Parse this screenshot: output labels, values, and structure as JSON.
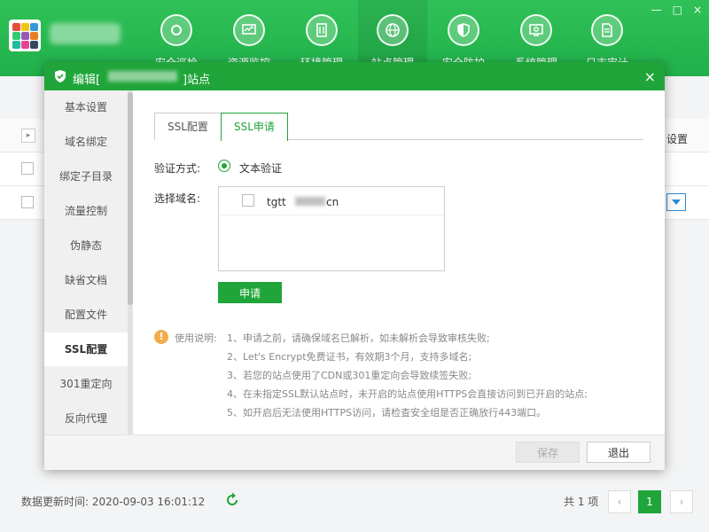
{
  "header": {
    "nav": [
      {
        "label": "安全巡检",
        "icon": "gear-cycle-icon",
        "active": false
      },
      {
        "label": "资源监控",
        "icon": "monitor-chart-icon",
        "active": false
      },
      {
        "label": "环境管理",
        "icon": "server-stack-icon",
        "active": false
      },
      {
        "label": "站点管理",
        "icon": "globe-icon",
        "active": true
      },
      {
        "label": "安全防护",
        "icon": "shield-icon",
        "active": false
      },
      {
        "label": "系统管理",
        "icon": "display-gear-icon",
        "active": false
      },
      {
        "label": "日志审计",
        "icon": "document-icon",
        "active": false
      }
    ],
    "window_controls": [
      "—",
      "□",
      "×"
    ]
  },
  "background": {
    "column_header_right": "设置",
    "update_text": "数据更新时间: 2020-09-03 16:01:12",
    "pager": {
      "total": "共 1 项",
      "prev": "‹",
      "current": "1",
      "next": "›"
    }
  },
  "modal": {
    "title_prefix": "编辑[",
    "title_suffix": "]站点",
    "close": "×",
    "side_menu": [
      {
        "label": "基本设置",
        "active": false
      },
      {
        "label": "域名绑定",
        "active": false
      },
      {
        "label": "绑定子目录",
        "active": false
      },
      {
        "label": "流量控制",
        "active": false
      },
      {
        "label": "伪静态",
        "active": false
      },
      {
        "label": "缺省文档",
        "active": false
      },
      {
        "label": "配置文件",
        "active": false
      },
      {
        "label": "SSL配置",
        "active": true
      },
      {
        "label": "301重定向",
        "active": false
      },
      {
        "label": "反向代理",
        "active": false
      }
    ],
    "tabs": [
      {
        "label": "SSL配置",
        "active": false
      },
      {
        "label": "SSL申请",
        "active": true
      }
    ],
    "verify_label": "验证方式:",
    "verify_option": "文本验证",
    "domain_label": "选择域名:",
    "domain": {
      "prefix": "tgtt",
      "suffix": "cn",
      "checked": false
    },
    "apply_button": "申请",
    "notes_label": "使用说明:",
    "notes": [
      "1、申请之前，请确保域名已解析，如未解析会导致审核失败;",
      "2、Let's Encrypt免费证书，有效期3个月，支持多域名;",
      "3、若您的站点使用了CDN或301重定向会导致续签失败;",
      "4、在未指定SSL默认站点时，未开启的站点使用HTTPS会直接访问到已开启的站点;",
      "5、如开启后无法使用HTTPS访问，请检查安全组是否正确放行443端口。"
    ],
    "save_button": "保存",
    "exit_button": "退出"
  },
  "colors": {
    "primary": "#20a53a",
    "header": "#24b24c",
    "warning": "#f0ad4e"
  }
}
